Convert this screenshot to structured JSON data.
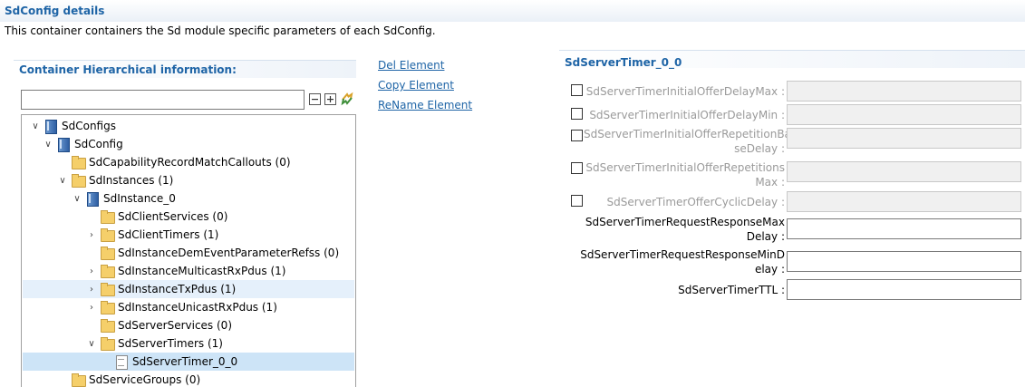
{
  "header": {
    "title": "SdConfig details",
    "description": "This container containers the Sd module specific parameters of each SdConfig."
  },
  "left_panel": {
    "title": "Container Hierarchical information:",
    "search": {
      "value": "",
      "placeholder": ""
    },
    "tools": [
      "collapse-all-icon",
      "expand-all-icon",
      "sync-icon"
    ]
  },
  "tree": [
    {
      "label": "SdConfigs",
      "icon": "config-icon",
      "expander": "expanded"
    },
    {
      "label": "SdConfig",
      "icon": "config-icon",
      "expander": "expanded"
    },
    {
      "label": "SdCapabilityRecordMatchCallouts (0)",
      "icon": "folder-icon",
      "expander": "none"
    },
    {
      "label": "SdInstances (1)",
      "icon": "folder-icon",
      "expander": "expanded"
    },
    {
      "label": "SdInstance_0",
      "icon": "config-icon",
      "expander": "expanded"
    },
    {
      "label": "SdClientServices (0)",
      "icon": "folder-icon",
      "expander": "none"
    },
    {
      "label": "SdClientTimers (1)",
      "icon": "folder-icon",
      "expander": "collapsed"
    },
    {
      "label": "SdInstanceDemEventParameterRefss (0)",
      "icon": "folder-icon",
      "expander": "none"
    },
    {
      "label": "SdInstanceMulticastRxPdus (1)",
      "icon": "folder-icon",
      "expander": "collapsed"
    },
    {
      "label": "SdInstanceTxPdus (1)",
      "icon": "folder-icon",
      "expander": "collapsed"
    },
    {
      "label": "SdInstanceUnicastRxPdus (1)",
      "icon": "folder-icon",
      "expander": "collapsed"
    },
    {
      "label": "SdServerServices (0)",
      "icon": "folder-icon",
      "expander": "none"
    },
    {
      "label": "SdServerTimers (1)",
      "icon": "folder-icon",
      "expander": "expanded"
    },
    {
      "label": "SdServerTimer_0_0",
      "icon": "document-icon",
      "expander": "none"
    },
    {
      "label": "SdServiceGroups (0)",
      "icon": "folder-icon",
      "expander": "none"
    }
  ],
  "actions": {
    "del": "Del Element",
    "copy": "Copy Element",
    "rename": "ReName Element"
  },
  "right_panel": {
    "title": "SdServerTimer_0_0",
    "fields": [
      {
        "label": "SdServerTimerInitialOfferDelayMax :",
        "checked": false,
        "enabled": false,
        "value": ""
      },
      {
        "label": "SdServerTimerInitialOfferDelayMin :",
        "checked": false,
        "enabled": false,
        "value": ""
      },
      {
        "label_line1": "SdServerTimerInitialOfferRepetitionBa",
        "label_line2": "seDelay :",
        "checked": false,
        "enabled": false,
        "value": ""
      },
      {
        "label_line1": "SdServerTimerInitialOfferRepetitions",
        "label_line2": "Max :",
        "checked": false,
        "enabled": false,
        "value": ""
      },
      {
        "label": "SdServerTimerOfferCyclicDelay :",
        "checked": false,
        "enabled": false,
        "value": ""
      },
      {
        "label_line1": "SdServerTimerRequestResponseMax",
        "label_line2": "Delay :",
        "enabled": true,
        "value": ""
      },
      {
        "label_line1": "SdServerTimerRequestResponseMinD",
        "label_line2": "elay :",
        "enabled": true,
        "value": ""
      },
      {
        "label": "SdServerTimerTTL :",
        "enabled": true,
        "value": ""
      }
    ]
  },
  "colors": {
    "title_blue": "#1e64a6",
    "selection": "#cde4f7",
    "hover": "#e5f0fb",
    "disabled_text": "#9a9a9a"
  }
}
